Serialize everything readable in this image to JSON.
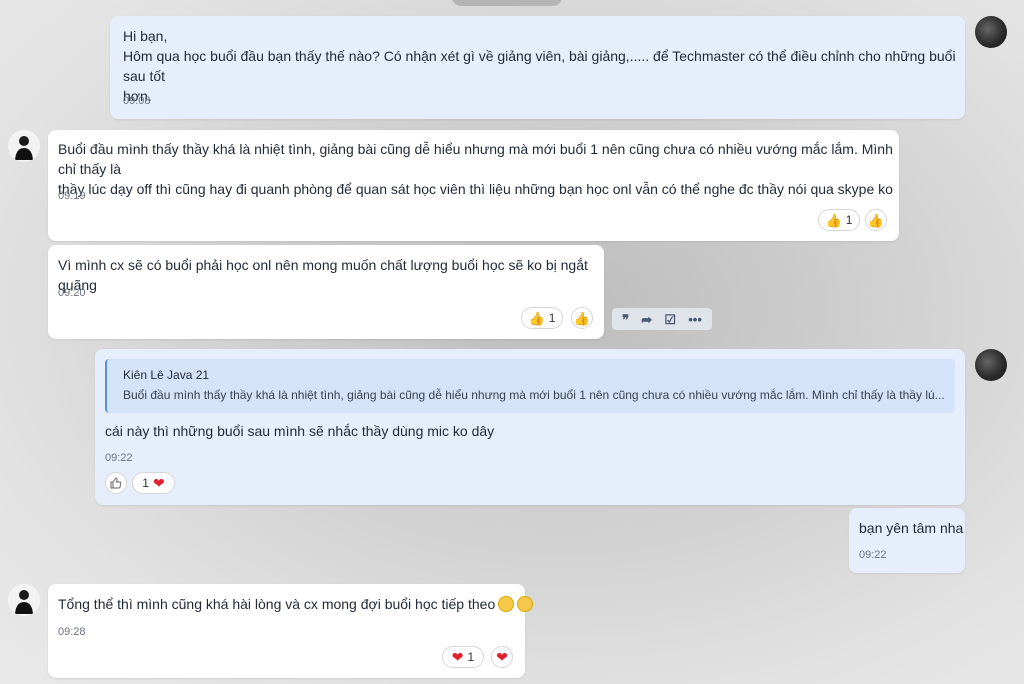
{
  "messages": [
    {
      "id": "m1",
      "sender": "self",
      "lines": [
        "Hi bạn,",
        "Hôm qua học buổi đầu bạn thấy thế nào? Có nhận xét gì về giảng viên, bài giảng,..... để Techmaster có thể điều chỉnh cho những buổi sau tốt",
        "hơn."
      ],
      "time": "09:08"
    },
    {
      "id": "m2",
      "sender": "other",
      "lines": [
        "Buổi đầu mình thấy thầy khá là nhiệt tình, giảng bài cũng dễ hiểu nhưng mà mới buổi 1 nên cũng chưa có nhiều vướng mắc lắm. Mình chỉ thấy là",
        "thầy lúc dạy off thì cũng hay đi quanh phòng để quan sát học viên thì liệu những bạn học onl vẫn có thể nghe đc thầy nói qua skype ko"
      ],
      "time": "09:19",
      "reaction_count": "1",
      "reaction": "thumbs-up"
    },
    {
      "id": "m3",
      "sender": "other",
      "lines": [
        "Vì mình cx sẽ có buổi phải học onl nên mong muốn chất lượng buổi học sẽ ko bị ngắt quãng"
      ],
      "time": "09:20",
      "reaction_count": "1",
      "reaction": "thumbs-up"
    },
    {
      "id": "m4",
      "sender": "self",
      "quote": {
        "author": "Kiên Lê Java 21",
        "text": "Buổi đầu mình thấy thầy khá là nhiệt tình, giảng bài cũng dễ hiểu nhưng mà mới buổi 1 nên cũng chưa có nhiều vướng mắc lắm. Mình chỉ thấy là thầy lú..."
      },
      "lines": [
        "cái này thì những buổi sau mình sẽ nhắc thầy dùng mic ko dây"
      ],
      "time": "09:22",
      "reaction_count": "1",
      "reaction": "heart"
    },
    {
      "id": "m5",
      "sender": "self",
      "lines": [
        "bạn yên tâm nha"
      ],
      "time": "09:22"
    },
    {
      "id": "m6",
      "sender": "other",
      "lines": [
        "Tổng thể thì mình cũng khá hài lòng và cx mong đợi buổi học tiếp theo"
      ],
      "time": "09:28",
      "reaction_count": "1",
      "reaction": "heart"
    }
  ],
  "icons": {
    "reply": "quote-icon",
    "forward": "share-icon",
    "task": "task-check-icon",
    "more": "more-icon",
    "thumbs_up": "thumbs-up-icon",
    "heart": "heart-icon",
    "smile": "grin-emoji-icon"
  }
}
